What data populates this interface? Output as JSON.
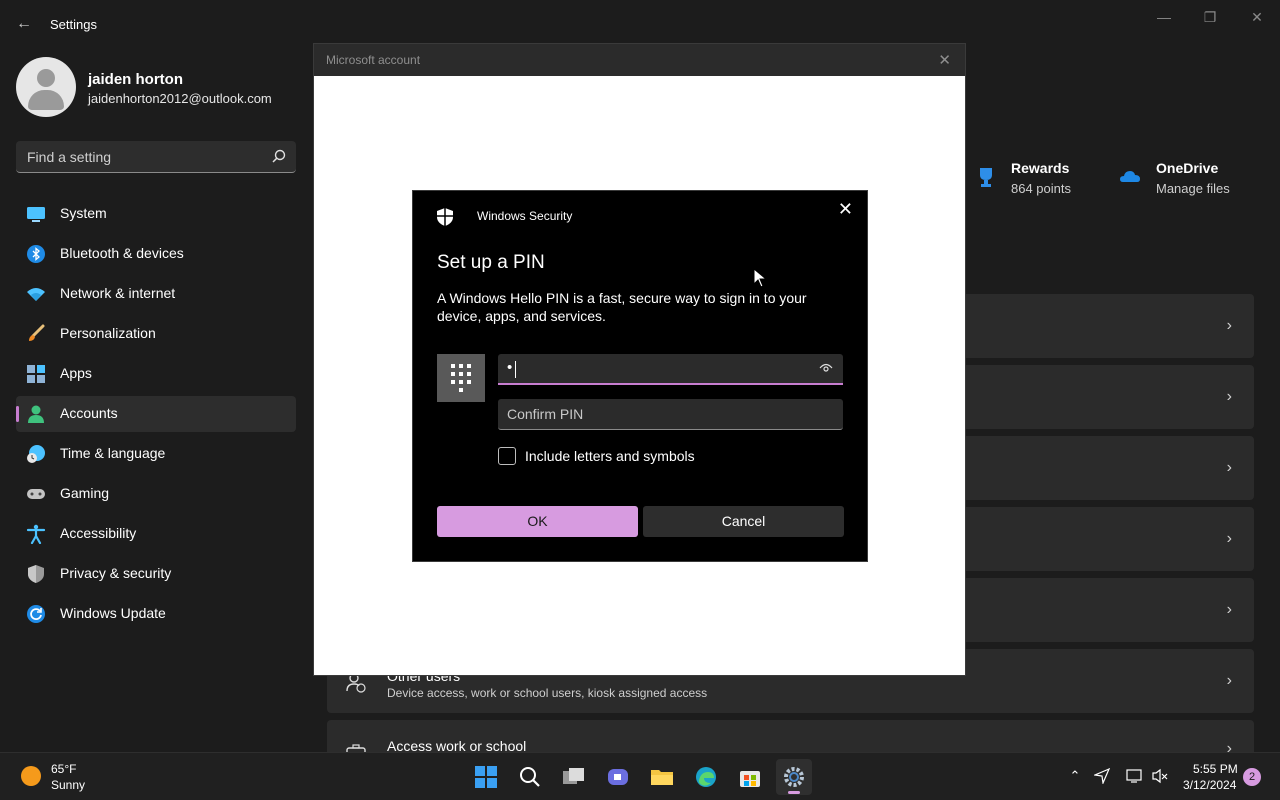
{
  "window": {
    "title": "Settings",
    "back_icon": "back-arrow-icon",
    "controls": [
      "minimize-icon",
      "restore-icon",
      "close-icon"
    ]
  },
  "profile": {
    "name": "jaiden horton",
    "email": "jaidenhorton2012@outlook.com"
  },
  "search": {
    "placeholder": "Find a setting"
  },
  "nav": [
    {
      "label": "System",
      "icon": "system-icon"
    },
    {
      "label": "Bluetooth & devices",
      "icon": "bluetooth-icon"
    },
    {
      "label": "Network & internet",
      "icon": "wifi-icon"
    },
    {
      "label": "Personalization",
      "icon": "brush-icon"
    },
    {
      "label": "Apps",
      "icon": "apps-icon"
    },
    {
      "label": "Accounts",
      "icon": "accounts-icon",
      "active": true
    },
    {
      "label": "Time & language",
      "icon": "clock-globe-icon"
    },
    {
      "label": "Gaming",
      "icon": "gamepad-icon"
    },
    {
      "label": "Accessibility",
      "icon": "accessibility-icon"
    },
    {
      "label": "Privacy & security",
      "icon": "shield-icon"
    },
    {
      "label": "Windows Update",
      "icon": "update-icon"
    }
  ],
  "tiles": {
    "rewards": {
      "title": "Rewards",
      "sub": "864 points"
    },
    "onedrive": {
      "title": "OneDrive",
      "sub": "Manage files"
    }
  },
  "cards": {
    "other_users": {
      "title": "Other users",
      "sub": "Device access, work or school users, kiosk assigned access"
    },
    "work_school": {
      "title": "Access work or school"
    }
  },
  "ms_dialog": {
    "title": "Microsoft account"
  },
  "security_dialog": {
    "app_name": "Windows Security",
    "heading": "Set up a PIN",
    "description": "A Windows Hello PIN is a fast, secure way to sign in to your device, apps, and services.",
    "pin_value": "•",
    "confirm_placeholder": "Confirm PIN",
    "checkbox_label": "Include letters and symbols",
    "checkbox_checked": false,
    "ok_label": "OK",
    "cancel_label": "Cancel"
  },
  "taskbar": {
    "weather_temp": "65°F",
    "weather_cond": "Sunny",
    "time": "5:55 PM",
    "date": "3/12/2024",
    "notification_count": "2"
  },
  "colors": {
    "accent": "#d79be0",
    "accent_strong": "#c77dd0",
    "background": "#1c1c1c",
    "card": "#2b2b2b"
  }
}
